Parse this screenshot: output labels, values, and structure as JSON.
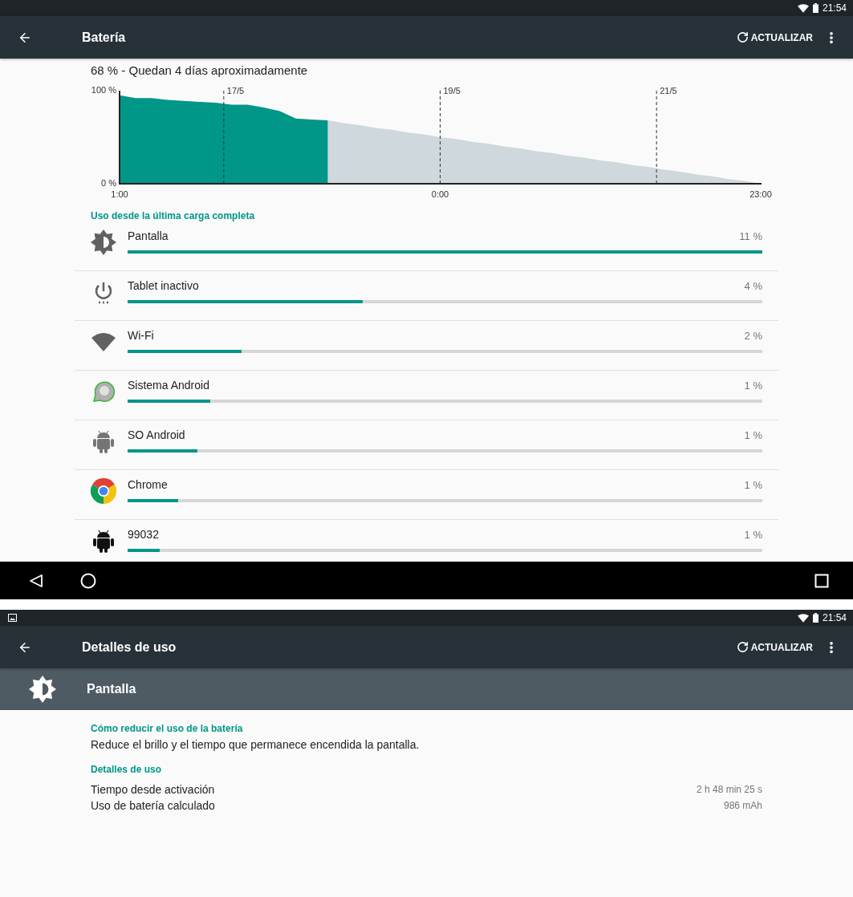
{
  "battery_screen": {
    "status_bar": {
      "time": "21:54"
    },
    "toolbar": {
      "title": "Batería",
      "action": "ACTUALIZAR"
    },
    "summary": "68 % - Quedan 4 días aproximadamente",
    "chart_data": {
      "type": "area",
      "categories": [
        "1:00",
        null,
        null,
        null,
        null,
        null,
        null,
        null,
        null,
        null,
        null,
        null,
        null,
        null,
        null,
        null,
        null,
        null,
        null,
        null,
        "0:00",
        null,
        null,
        null,
        null,
        null,
        null,
        null,
        null,
        null,
        null,
        null,
        null,
        null,
        null,
        null,
        null,
        null,
        null,
        null,
        "23:00"
      ],
      "series": [
        {
          "color": "#009688",
          "values": [
            95,
            92,
            92,
            90,
            89,
            88,
            87,
            85,
            85,
            82,
            78,
            70,
            69,
            68,
            null,
            null,
            null,
            null,
            null,
            null,
            null,
            null,
            null,
            null,
            null,
            null,
            null,
            null,
            null,
            null,
            null,
            null,
            null,
            null,
            null,
            null,
            null,
            null,
            null,
            null,
            null
          ]
        },
        {
          "color": "#cfd8dc",
          "values": [
            null,
            null,
            null,
            null,
            null,
            null,
            null,
            null,
            null,
            null,
            null,
            null,
            null,
            68,
            65,
            63,
            60,
            58,
            55,
            53,
            50,
            48,
            45,
            43,
            40,
            38,
            35,
            33,
            30,
            28,
            25,
            23,
            20,
            18,
            15,
            13,
            10,
            8,
            5,
            3,
            0
          ]
        }
      ],
      "ylim": [
        0,
        100
      ],
      "yticks": [
        {
          "value": 0,
          "label": "0 %"
        },
        {
          "value": 100,
          "label": "100 %"
        }
      ],
      "annotations": [
        "17/5",
        "19/5",
        "21/5"
      ]
    },
    "usage": {
      "heading": "Uso desde la última carga completa",
      "items": [
        {
          "kind": "brightness",
          "name": "Pantalla",
          "percent": "11 %",
          "level": 1.0
        },
        {
          "kind": "power",
          "name": "Tablet inactivo",
          "percent": "4 %",
          "level": 0.37
        },
        {
          "kind": "wifi",
          "name": "Wi-Fi",
          "percent": "2 %",
          "level": 0.18
        },
        {
          "kind": "system",
          "name": "Sistema Android",
          "percent": "1 %",
          "level": 0.13
        },
        {
          "kind": "android",
          "name": "SO Android",
          "percent": "1 %",
          "level": 0.11
        },
        {
          "kind": "chrome",
          "name": "Chrome",
          "percent": "1 %",
          "level": 0.08
        },
        {
          "kind": "android_dark",
          "name": "99032",
          "percent": "1 %",
          "level": 0.05
        }
      ]
    }
  },
  "details_screen": {
    "status_bar": {
      "time": "21:54"
    },
    "toolbar": {
      "title": "Detalles de uso",
      "action": "ACTUALIZAR"
    },
    "header": {
      "title": "Pantalla"
    },
    "tip": {
      "heading": "Cómo reducir el uso de la batería",
      "text": "Reduce el brillo y el tiempo que permanece encendida la pantalla."
    },
    "details": {
      "heading": "Detalles de uso",
      "rows": [
        {
          "label": "Tiempo desde activación",
          "value": "2 h 48 min 25 s"
        },
        {
          "label": "Uso de batería calculado",
          "value": "986 mAh"
        }
      ]
    }
  }
}
